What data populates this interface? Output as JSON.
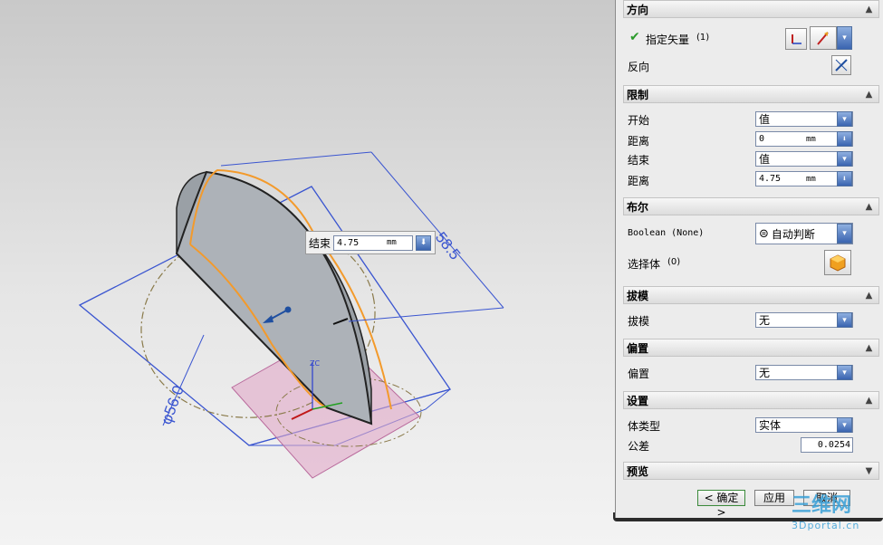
{
  "canvas": {
    "dim_length": "58.5",
    "dim_diameter": "φ56.0",
    "axis_label": "ZC",
    "float_input": {
      "label": "结束",
      "value": "4.75",
      "unit": "mm"
    }
  },
  "direction": {
    "title": "方向",
    "vector_label": "指定矢量",
    "vector_count": "(1)",
    "reverse_label": "反向"
  },
  "limits": {
    "title": "限制",
    "start_label": "开始",
    "start_value": "值",
    "start_dist_label": "距离",
    "start_dist_value": "0",
    "start_dist_unit": "mm",
    "end_label": "结束",
    "end_value": "值",
    "end_dist_label": "距离",
    "end_dist_value": "4.75",
    "end_dist_unit": "mm"
  },
  "boolean": {
    "title": "布尔",
    "bool_label": "Boolean (None)",
    "bool_value": "自动判断",
    "select_body_label": "选择体",
    "select_body_count": "(0)"
  },
  "draft": {
    "title": "拔模",
    "label": "拔模",
    "value": "无"
  },
  "offset": {
    "title": "偏置",
    "label": "偏置",
    "value": "无"
  },
  "settings": {
    "title": "设置",
    "body_type_label": "体类型",
    "body_type_value": "实体",
    "tolerance_label": "公差",
    "tolerance_value": "0.0254"
  },
  "preview": {
    "title": "预览"
  },
  "buttons": {
    "ok": "< 确定 >",
    "apply": "应用",
    "cancel": "取消"
  },
  "watermark": {
    "main": "三维网",
    "sub": "3Dportal.cn"
  },
  "icons": {
    "check": "check-icon",
    "vector_type": "vector-icon",
    "reverse": "reverse-icon",
    "body": "solid-body-icon",
    "boolean": "boolean-icon",
    "collapse": "chevron-up-icon",
    "expand": "chevron-down-icon",
    "dropdown": "dropdown-arrow-icon"
  }
}
